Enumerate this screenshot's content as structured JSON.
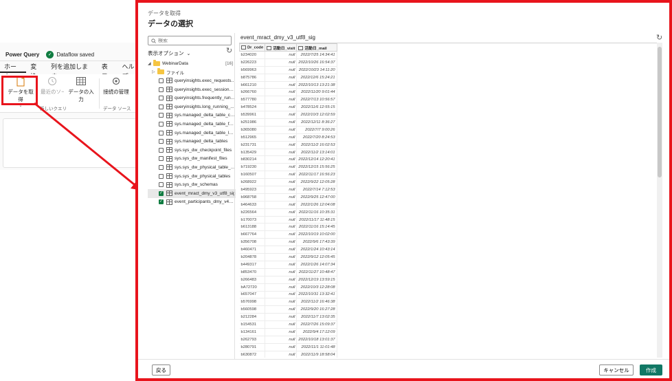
{
  "power_query": {
    "app_title": "Power Query",
    "saved_status": "Dataflow saved",
    "tabs": [
      "ホーム",
      "変換",
      "列を追加します",
      "表示",
      "ヘルプ"
    ],
    "ribbon": {
      "get_data": "データを取得",
      "recent_sources": "最近のソース",
      "enter_data": "データの入力",
      "manage_connections": "接続の管理",
      "group_new_query": "新しいクエリ",
      "group_data_source": "データ ソース"
    }
  },
  "dialog": {
    "subtitle": "データを取得",
    "title": "データの選択",
    "search_placeholder": "検索",
    "view_options": "表示オプション",
    "tree": {
      "root": {
        "label": "WebinarData",
        "count": "[16]"
      },
      "folder": "ファイル",
      "items": [
        {
          "label": "queryinsights.exec_requests_...",
          "checked": false
        },
        {
          "label": "queryinsights.exec_sessions_...",
          "checked": false
        },
        {
          "label": "queryinsights.frequently_run_...",
          "checked": false
        },
        {
          "label": "queryinsights.long_running_...",
          "checked": false
        },
        {
          "label": "sys.managed_delta_table_che...",
          "checked": false
        },
        {
          "label": "sys.managed_delta_table_forks",
          "checked": false
        },
        {
          "label": "sys.managed_delta_table_log...",
          "checked": false
        },
        {
          "label": "sys.managed_delta_tables",
          "checked": false
        },
        {
          "label": "sys.sys_dw_checkpoint_files",
          "checked": false
        },
        {
          "label": "sys.sys_dw_manifest_files",
          "checked": false
        },
        {
          "label": "sys.sys_dw_physical_table_for...",
          "checked": false
        },
        {
          "label": "sys.sys_dw_physical_tables",
          "checked": false
        },
        {
          "label": "sys.sys_dw_schemas",
          "checked": false
        },
        {
          "label": "event_mract_dmy_v3_utf8_sig",
          "checked": true
        },
        {
          "label": "event_participants_dmy_v4_u...",
          "checked": true
        }
      ]
    },
    "preview": {
      "title": "event_mract_dmy_v3_utf8_sig",
      "columns": [
        "Dr_code",
        "活動日_visit",
        "活動日_mail"
      ],
      "rows": [
        [
          "b234020",
          "null",
          "2022/7/25 14:34:41"
        ],
        [
          "b226223",
          "null",
          "2022/10/26 16:54:37"
        ],
        [
          "b569963",
          "null",
          "2022/10/23 14:11:20"
        ],
        [
          "b875786",
          "null",
          "2022/12/6 15:24:21"
        ],
        [
          "b661210",
          "null",
          "2022/10/13 13:21:38"
        ],
        [
          "b266760",
          "null",
          "2022/11/20 9:01:44"
        ],
        [
          "b577780",
          "null",
          "2022/7/13 10:56:57"
        ],
        [
          "b478524",
          "null",
          "2022/11/6 12:55:15"
        ],
        [
          "b539961",
          "null",
          "2022/10/3 12:02:59"
        ],
        [
          "b251986",
          "null",
          "2022/12/11 8:36:27"
        ],
        [
          "b365080",
          "null",
          "2022/7/7 9:00:26"
        ],
        [
          "b512965",
          "null",
          "2022/7/20 8:24:53"
        ],
        [
          "b231731",
          "null",
          "2022/11/2 16:02:53"
        ],
        [
          "b135429",
          "null",
          "2022/11/2 13:14:01"
        ],
        [
          "b830214",
          "null",
          "2022/12/14 12:20:41"
        ],
        [
          "b719230",
          "null",
          "2022/12/15 15:56:25"
        ],
        [
          "b160507",
          "null",
          "2022/11/17 16:56:23"
        ],
        [
          "b268922",
          "null",
          "2022/9/22 12:05:28"
        ],
        [
          "b495923",
          "null",
          "2022/7/14 7:12:53"
        ],
        [
          "b968758",
          "null",
          "2022/9/25 12:47:00"
        ],
        [
          "b464633",
          "null",
          "2022/1/26 12:04:08"
        ],
        [
          "b226564",
          "null",
          "2022/11/16 10:35:31"
        ],
        [
          "b170073",
          "null",
          "2022/11/17 11:48:15"
        ],
        [
          "b613188",
          "null",
          "2022/11/16 15:14:45"
        ],
        [
          "b667764",
          "null",
          "2022/10/19 10:02:00"
        ],
        [
          "b356708",
          "null",
          "2022/9/6 17:43:39"
        ],
        [
          "b460471",
          "null",
          "2022/1/24 10:43:14"
        ],
        [
          "b204878",
          "null",
          "2022/9/12 12:05:45"
        ],
        [
          "b449317",
          "null",
          "2022/1/26 14:07:34"
        ],
        [
          "b853470",
          "null",
          "2022/11/27 10:48:47"
        ],
        [
          "b266483",
          "null",
          "2022/12/19 13:59:15"
        ],
        [
          "bA72720",
          "null",
          "2022/10/3 12:28:08"
        ],
        [
          "b657047",
          "null",
          "2022/10/31 13:32:41"
        ],
        [
          "b576998",
          "null",
          "2022/11/2 16:46:38"
        ],
        [
          "b560598",
          "null",
          "2022/9/20 16:27:28"
        ],
        [
          "b212284",
          "null",
          "2022/11/7 13:02:35"
        ],
        [
          "b154531",
          "null",
          "2022/7/26 15:09:37"
        ],
        [
          "b134161",
          "null",
          "2022/9/4 17:12:09"
        ],
        [
          "b262793",
          "null",
          "2022/10/18 13:01:37"
        ],
        [
          "b280791",
          "null",
          "2022/11/1 11:01:48"
        ],
        [
          "b630872",
          "null",
          "2022/11/9 18:58:04"
        ]
      ]
    },
    "buttons": {
      "back": "戻る",
      "cancel": "キャンセル",
      "create": "作成"
    }
  },
  "colors": {
    "highlight": "#e8141c",
    "primary": "#117865",
    "check": "#107c41"
  }
}
